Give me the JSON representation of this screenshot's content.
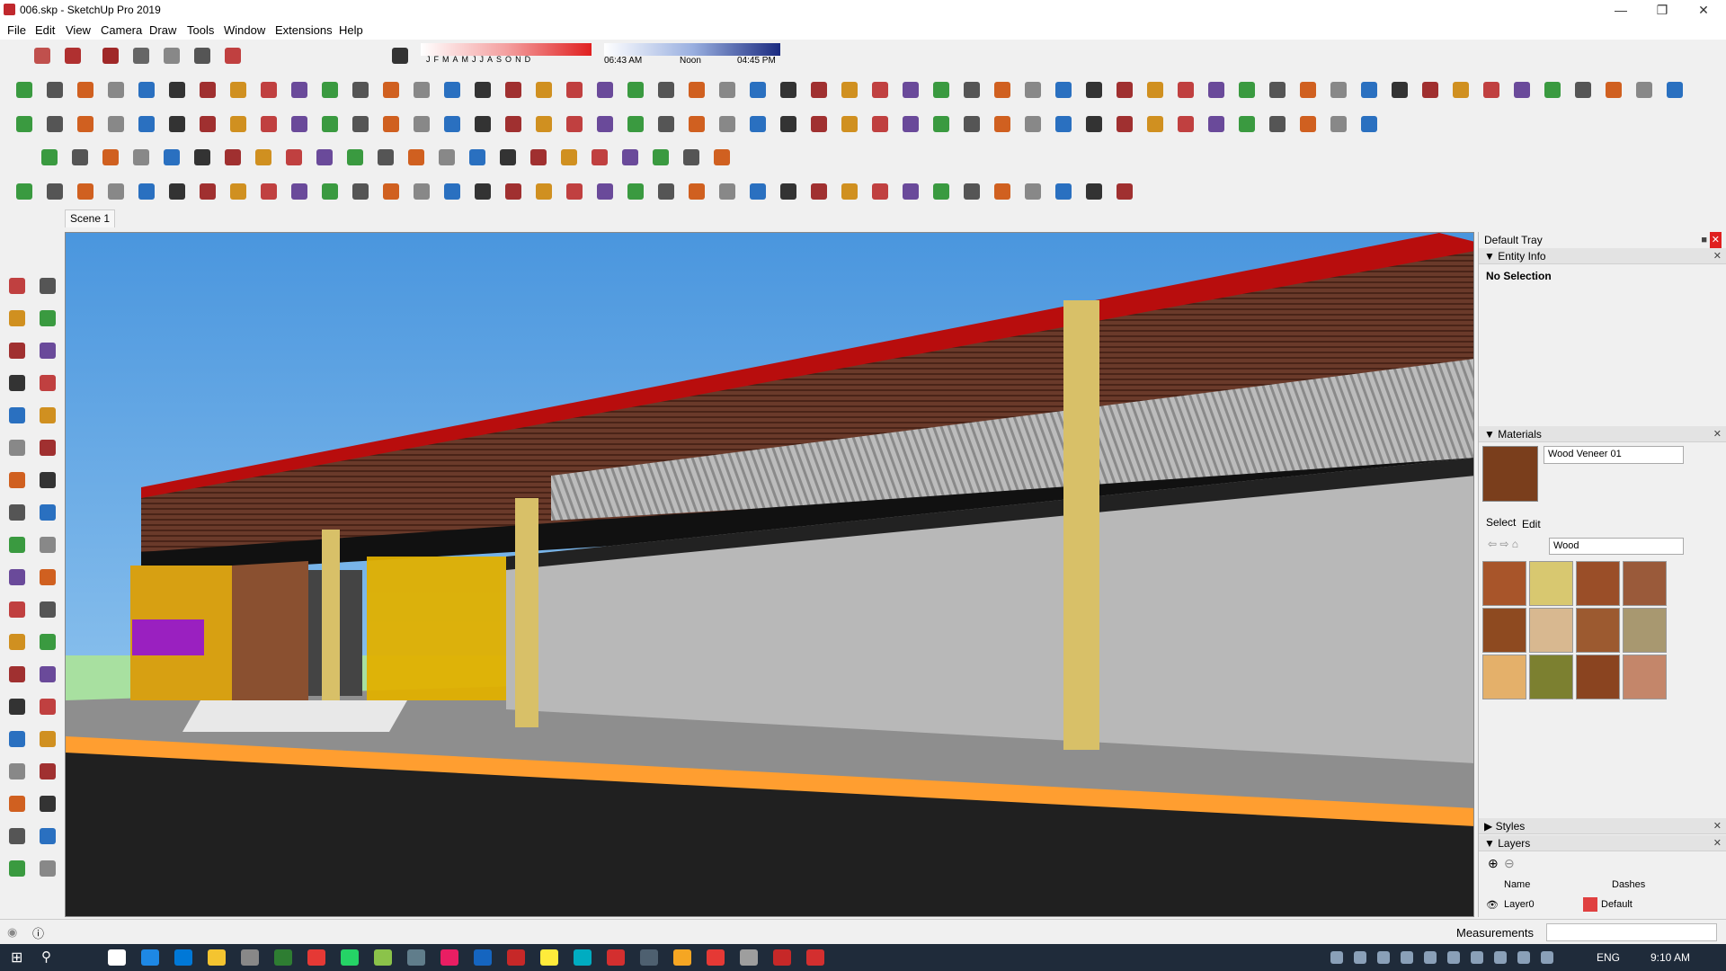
{
  "window": {
    "title": "006.skp - SketchUp Pro 2019"
  },
  "menu": [
    "File",
    "Edit",
    "View",
    "Camera",
    "Draw",
    "Tools",
    "Window",
    "Extensions",
    "Help"
  ],
  "shadows": {
    "months": [
      "J",
      "F",
      "M",
      "A",
      "M",
      "J",
      "J",
      "A",
      "S",
      "O",
      "N",
      "D"
    ],
    "time_start": "06:43 AM",
    "time_mid": "Noon",
    "time_end": "04:45 PM"
  },
  "scene_tab": "Scene 1",
  "tray": {
    "title": "Default Tray",
    "entity_info": {
      "header": "Entity Info",
      "selection": "No Selection"
    },
    "materials": {
      "header": "Materials",
      "name": "Wood Veneer 01",
      "tab_select": "Select",
      "tab_edit": "Edit",
      "collection": "Wood",
      "swatches": [
        "#a8552a",
        "#d8c870",
        "#9a4e28",
        "#9a5a3a",
        "#8e4a20",
        "#d8b890",
        "#9c5a30",
        "#a89870",
        "#e4b06a",
        "#7c8030",
        "#8a4420",
        "#c4866a"
      ]
    },
    "styles": {
      "header": "Styles"
    },
    "layers": {
      "header": "Layers",
      "col_name": "Name",
      "col_dashes": "Dashes",
      "rows": [
        {
          "name": "Layer0",
          "dashes": "Default",
          "color": "#e04040"
        }
      ]
    }
  },
  "status": {
    "measurements_label": "Measurements"
  },
  "taskbar": {
    "lang": "ENG",
    "time": "9:10 AM"
  },
  "colors": {
    "accent": "#0078d7",
    "roof_red": "#c01010",
    "wood": "#6a3a2a",
    "orange": "#ff9e40"
  }
}
